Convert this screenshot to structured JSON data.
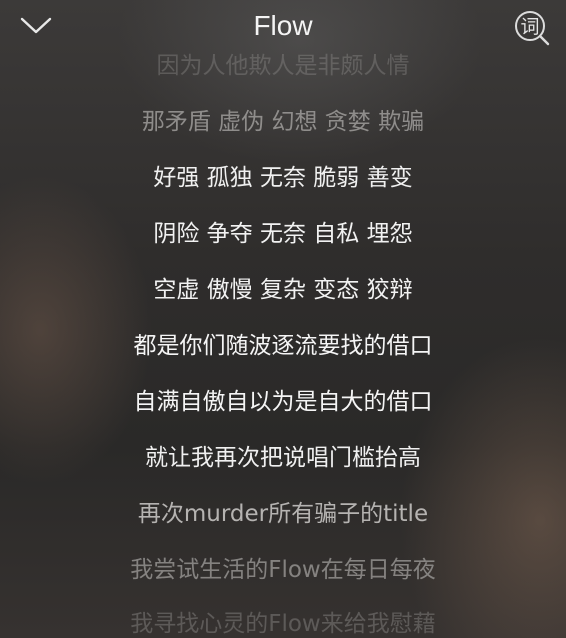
{
  "header": {
    "title": "Flow",
    "collapse_icon": "chevron-down-icon",
    "lyric_icon": "lyric-search-icon",
    "lyric_glyph": "词"
  },
  "lyrics": {
    "lines": [
      "因为人他欺人是非颇人情",
      "那矛盾 虚伪 幻想 贪婪 欺骗",
      "好强 孤独 无奈 脆弱 善变",
      "阴险 争夺 无奈 自私 埋怨",
      "空虚 傲慢 复杂 变态 狡辩",
      "都是你们随波逐流要找的借口",
      "自满自傲自以为是自大的借口",
      "就让我再次把说唱门槛抬高",
      "再次murder所有骗子的title",
      "我尝试生活的Flow在每日每夜",
      "我寻找心灵的Flow来给我慰藉"
    ]
  }
}
